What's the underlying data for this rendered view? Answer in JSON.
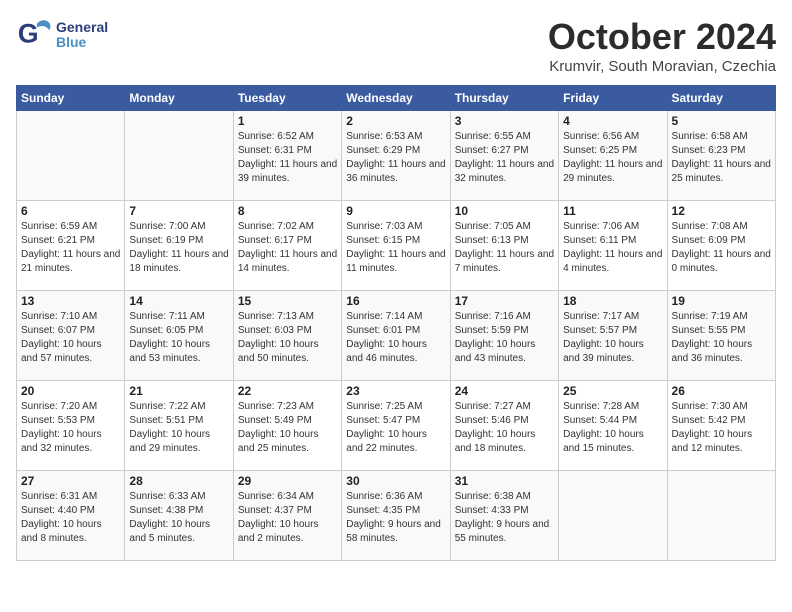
{
  "header": {
    "logo_general": "General",
    "logo_blue": "Blue",
    "month": "October 2024",
    "location": "Krumvir, South Moravian, Czechia"
  },
  "columns": [
    "Sunday",
    "Monday",
    "Tuesday",
    "Wednesday",
    "Thursday",
    "Friday",
    "Saturday"
  ],
  "weeks": [
    [
      {
        "day": "",
        "info": ""
      },
      {
        "day": "",
        "info": ""
      },
      {
        "day": "1",
        "info": "Sunrise: 6:52 AM\nSunset: 6:31 PM\nDaylight: 11 hours and 39 minutes."
      },
      {
        "day": "2",
        "info": "Sunrise: 6:53 AM\nSunset: 6:29 PM\nDaylight: 11 hours and 36 minutes."
      },
      {
        "day": "3",
        "info": "Sunrise: 6:55 AM\nSunset: 6:27 PM\nDaylight: 11 hours and 32 minutes."
      },
      {
        "day": "4",
        "info": "Sunrise: 6:56 AM\nSunset: 6:25 PM\nDaylight: 11 hours and 29 minutes."
      },
      {
        "day": "5",
        "info": "Sunrise: 6:58 AM\nSunset: 6:23 PM\nDaylight: 11 hours and 25 minutes."
      }
    ],
    [
      {
        "day": "6",
        "info": "Sunrise: 6:59 AM\nSunset: 6:21 PM\nDaylight: 11 hours and 21 minutes."
      },
      {
        "day": "7",
        "info": "Sunrise: 7:00 AM\nSunset: 6:19 PM\nDaylight: 11 hours and 18 minutes."
      },
      {
        "day": "8",
        "info": "Sunrise: 7:02 AM\nSunset: 6:17 PM\nDaylight: 11 hours and 14 minutes."
      },
      {
        "day": "9",
        "info": "Sunrise: 7:03 AM\nSunset: 6:15 PM\nDaylight: 11 hours and 11 minutes."
      },
      {
        "day": "10",
        "info": "Sunrise: 7:05 AM\nSunset: 6:13 PM\nDaylight: 11 hours and 7 minutes."
      },
      {
        "day": "11",
        "info": "Sunrise: 7:06 AM\nSunset: 6:11 PM\nDaylight: 11 hours and 4 minutes."
      },
      {
        "day": "12",
        "info": "Sunrise: 7:08 AM\nSunset: 6:09 PM\nDaylight: 11 hours and 0 minutes."
      }
    ],
    [
      {
        "day": "13",
        "info": "Sunrise: 7:10 AM\nSunset: 6:07 PM\nDaylight: 10 hours and 57 minutes."
      },
      {
        "day": "14",
        "info": "Sunrise: 7:11 AM\nSunset: 6:05 PM\nDaylight: 10 hours and 53 minutes."
      },
      {
        "day": "15",
        "info": "Sunrise: 7:13 AM\nSunset: 6:03 PM\nDaylight: 10 hours and 50 minutes."
      },
      {
        "day": "16",
        "info": "Sunrise: 7:14 AM\nSunset: 6:01 PM\nDaylight: 10 hours and 46 minutes."
      },
      {
        "day": "17",
        "info": "Sunrise: 7:16 AM\nSunset: 5:59 PM\nDaylight: 10 hours and 43 minutes."
      },
      {
        "day": "18",
        "info": "Sunrise: 7:17 AM\nSunset: 5:57 PM\nDaylight: 10 hours and 39 minutes."
      },
      {
        "day": "19",
        "info": "Sunrise: 7:19 AM\nSunset: 5:55 PM\nDaylight: 10 hours and 36 minutes."
      }
    ],
    [
      {
        "day": "20",
        "info": "Sunrise: 7:20 AM\nSunset: 5:53 PM\nDaylight: 10 hours and 32 minutes."
      },
      {
        "day": "21",
        "info": "Sunrise: 7:22 AM\nSunset: 5:51 PM\nDaylight: 10 hours and 29 minutes."
      },
      {
        "day": "22",
        "info": "Sunrise: 7:23 AM\nSunset: 5:49 PM\nDaylight: 10 hours and 25 minutes."
      },
      {
        "day": "23",
        "info": "Sunrise: 7:25 AM\nSunset: 5:47 PM\nDaylight: 10 hours and 22 minutes."
      },
      {
        "day": "24",
        "info": "Sunrise: 7:27 AM\nSunset: 5:46 PM\nDaylight: 10 hours and 18 minutes."
      },
      {
        "day": "25",
        "info": "Sunrise: 7:28 AM\nSunset: 5:44 PM\nDaylight: 10 hours and 15 minutes."
      },
      {
        "day": "26",
        "info": "Sunrise: 7:30 AM\nSunset: 5:42 PM\nDaylight: 10 hours and 12 minutes."
      }
    ],
    [
      {
        "day": "27",
        "info": "Sunrise: 6:31 AM\nSunset: 4:40 PM\nDaylight: 10 hours and 8 minutes."
      },
      {
        "day": "28",
        "info": "Sunrise: 6:33 AM\nSunset: 4:38 PM\nDaylight: 10 hours and 5 minutes."
      },
      {
        "day": "29",
        "info": "Sunrise: 6:34 AM\nSunset: 4:37 PM\nDaylight: 10 hours and 2 minutes."
      },
      {
        "day": "30",
        "info": "Sunrise: 6:36 AM\nSunset: 4:35 PM\nDaylight: 9 hours and 58 minutes."
      },
      {
        "day": "31",
        "info": "Sunrise: 6:38 AM\nSunset: 4:33 PM\nDaylight: 9 hours and 55 minutes."
      },
      {
        "day": "",
        "info": ""
      },
      {
        "day": "",
        "info": ""
      }
    ]
  ]
}
